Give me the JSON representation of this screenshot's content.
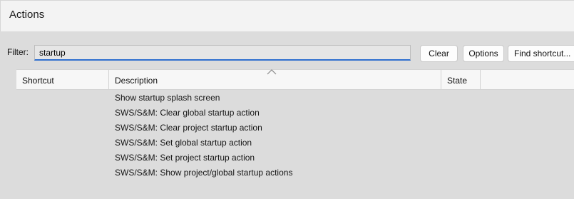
{
  "window": {
    "title": "Actions"
  },
  "filter": {
    "label": "Filter:",
    "value": "startup",
    "buttons": {
      "clear": "Clear",
      "options": "Options",
      "find_shortcut": "Find shortcut..."
    }
  },
  "table": {
    "columns": [
      "Shortcut",
      "Description",
      "State"
    ],
    "sorted_by": "Description",
    "rows": [
      {
        "shortcut": "",
        "description": "Show startup splash screen",
        "state": ""
      },
      {
        "shortcut": "",
        "description": "SWS/S&M: Clear global startup action",
        "state": ""
      },
      {
        "shortcut": "",
        "description": "SWS/S&M: Clear project startup action",
        "state": ""
      },
      {
        "shortcut": "",
        "description": "SWS/S&M: Set global startup action",
        "state": ""
      },
      {
        "shortcut": "",
        "description": "SWS/S&M: Set project startup action",
        "state": ""
      },
      {
        "shortcut": "",
        "description": "SWS/S&M: Show project/global startup actions",
        "state": ""
      }
    ]
  },
  "colors": {
    "accent": "#2f6fcf",
    "background": "#dcdcdc"
  }
}
